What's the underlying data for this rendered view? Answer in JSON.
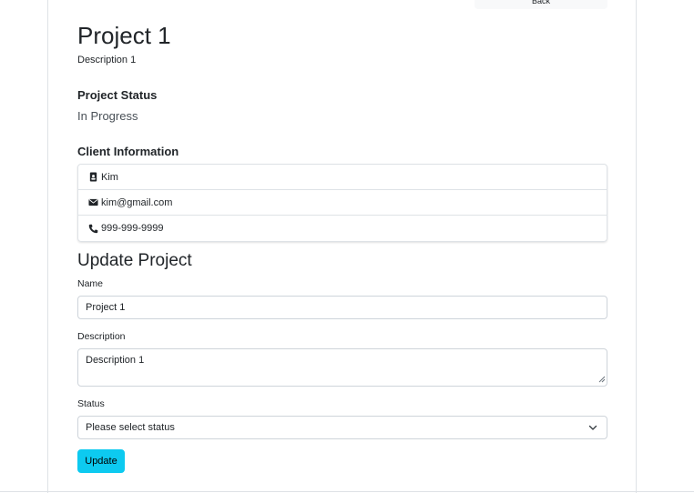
{
  "header": {
    "back_label": "Back"
  },
  "project": {
    "title": "Project 1",
    "description": "Description 1",
    "status_heading": "Project Status",
    "status_value": "In Progress"
  },
  "client": {
    "heading": "Client Information",
    "name": "Kim",
    "email": "kim@gmail.com",
    "phone": "999-999-9999",
    "icons": {
      "name": "id-badge-icon",
      "email": "envelope-icon",
      "phone": "phone-icon"
    }
  },
  "update_form": {
    "heading": "Update Project",
    "name_label": "Name",
    "name_value": "Project 1",
    "description_label": "Description",
    "description_value": "Description 1",
    "status_label": "Status",
    "status_selected": "Please select status",
    "submit_label": "Update"
  },
  "colors": {
    "accent": "#0dcaf0",
    "border": "#dee2e6",
    "muted_text": "#495057"
  }
}
